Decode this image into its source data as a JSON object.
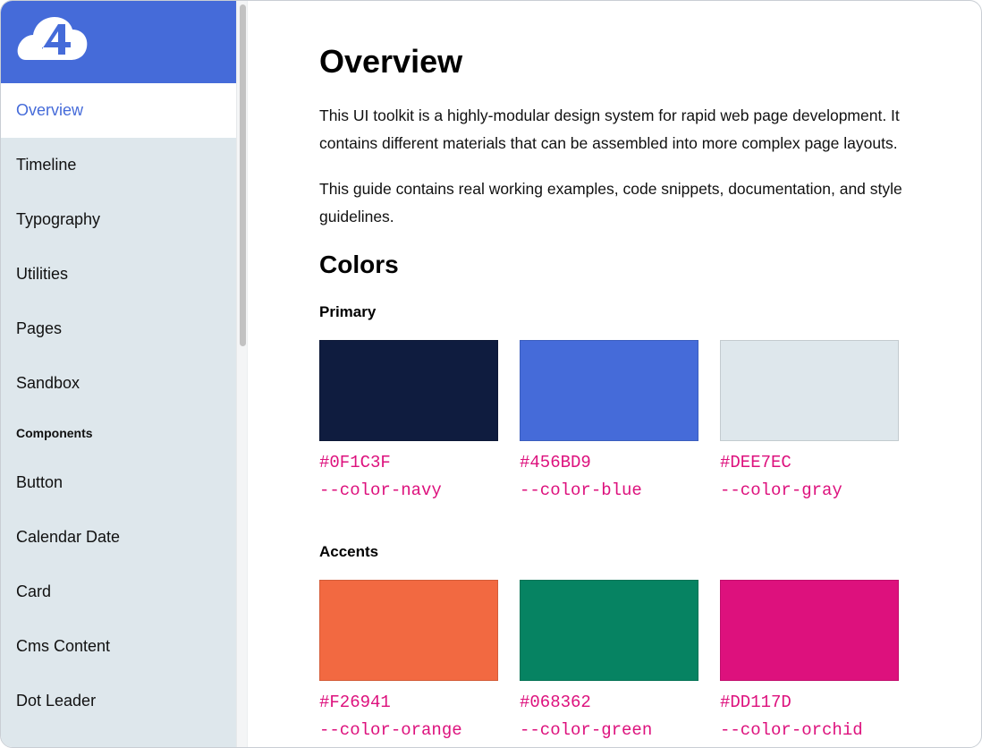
{
  "sidebar": {
    "logo_label": "4",
    "items": [
      {
        "label": "Overview",
        "active": true
      },
      {
        "label": "Timeline"
      },
      {
        "label": "Typography"
      },
      {
        "label": "Utilities"
      },
      {
        "label": "Pages"
      },
      {
        "label": "Sandbox"
      }
    ],
    "section_heading": "Components",
    "component_items": [
      {
        "label": "Button"
      },
      {
        "label": "Calendar Date"
      },
      {
        "label": "Card"
      },
      {
        "label": "Cms Content"
      },
      {
        "label": "Dot Leader"
      }
    ]
  },
  "main": {
    "title": "Overview",
    "paragraphs": [
      "This UI toolkit is a highly-modular design system for rapid web page development. It contains different materials that can be assembled into more complex page layouts.",
      "This guide contains real working examples, code snippets, documentation, and style guidelines."
    ],
    "colors_heading": "Colors",
    "primary_heading": "Primary",
    "primary": [
      {
        "hex": "#0F1C3F",
        "var": "--color-navy",
        "color": "#0f1c3f"
      },
      {
        "hex": "#456BD9",
        "var": "--color-blue",
        "color": "#456bd9"
      },
      {
        "hex": "#DEE7EC",
        "var": "--color-gray",
        "color": "#dee7ec"
      }
    ],
    "accents_heading": "Accents",
    "accents": [
      {
        "hex": "#F26941",
        "var": "--color-orange",
        "color": "#f26941"
      },
      {
        "hex": "#068362",
        "var": "--color-green",
        "color": "#068362"
      },
      {
        "hex": "#DD117D",
        "var": "--color-orchid",
        "color": "#dd117d"
      }
    ]
  },
  "theme": {
    "accent": "#456bd9",
    "sidebar_bg": "#dee7ec",
    "code_color": "#dd117d"
  }
}
